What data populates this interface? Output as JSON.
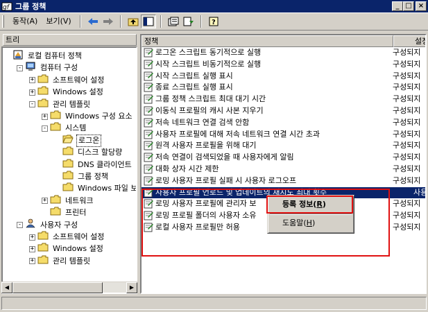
{
  "window": {
    "title": "그룹 정책",
    "minimize": "_",
    "maximize": "□",
    "close": "×"
  },
  "toolbar": {
    "menu_action_label": "동작(A)",
    "menu_view_label": "보기(V)",
    "tools": [
      "back-icon",
      "forward-icon",
      "up-folder-icon",
      "show-hide-tree-icon",
      "properties-icon",
      "export-list-icon",
      "help-icon"
    ]
  },
  "tree": {
    "header": "트리",
    "items": [
      {
        "label": "로컬 컴퓨터 정책",
        "level": 0,
        "expander": "",
        "icon": "policy-icon"
      },
      {
        "label": "컴퓨터 구성",
        "level": 1,
        "expander": "-",
        "icon": "computer-icon"
      },
      {
        "label": "소프트웨어 설정",
        "level": 2,
        "expander": "+",
        "icon": "folder-icon"
      },
      {
        "label": "Windows 설정",
        "level": 2,
        "expander": "+",
        "icon": "folder-icon"
      },
      {
        "label": "관리 템플릿",
        "level": 2,
        "expander": "-",
        "icon": "folder-icon"
      },
      {
        "label": "Windows 구성 요소",
        "level": 3,
        "expander": "+",
        "icon": "folder-icon"
      },
      {
        "label": "시스템",
        "level": 3,
        "expander": "-",
        "icon": "folder-icon"
      },
      {
        "label": "로그온",
        "level": 4,
        "expander": "",
        "icon": "folder-open-icon",
        "selected": true
      },
      {
        "label": "디스크 할당량",
        "level": 4,
        "expander": "",
        "icon": "folder-icon"
      },
      {
        "label": "DNS 클라이언트",
        "level": 4,
        "expander": "",
        "icon": "folder-icon"
      },
      {
        "label": "그룹 정책",
        "level": 4,
        "expander": "",
        "icon": "folder-icon"
      },
      {
        "label": "Windows 파일 보",
        "level": 4,
        "expander": "",
        "icon": "folder-icon"
      },
      {
        "label": "네트워크",
        "level": 3,
        "expander": "+",
        "icon": "folder-icon"
      },
      {
        "label": "프린터",
        "level": 3,
        "expander": "",
        "icon": "folder-icon"
      },
      {
        "label": "사용자 구성",
        "level": 1,
        "expander": "-",
        "icon": "user-icon"
      },
      {
        "label": "소프트웨어 설정",
        "level": 2,
        "expander": "+",
        "icon": "folder-icon"
      },
      {
        "label": "Windows 설정",
        "level": 2,
        "expander": "+",
        "icon": "folder-icon"
      },
      {
        "label": "관리 템플릿",
        "level": 2,
        "expander": "+",
        "icon": "folder-icon"
      }
    ]
  },
  "list": {
    "col_policy": "정책",
    "col_state": "설정",
    "rows": [
      {
        "name": "로그온 스크립트 동기적으로 실행",
        "state": "구성되지"
      },
      {
        "name": "시작 스크립트 비동기적으로 실행",
        "state": "구성되지"
      },
      {
        "name": "시작 스크립트 실행 표시",
        "state": "구성되지"
      },
      {
        "name": "종료 스크립트 실행 표시",
        "state": "구성되지"
      },
      {
        "name": "그룹 정책 스크립트 최대 대기 시간",
        "state": "구성되지"
      },
      {
        "name": "이동식 프로필의 캐시 사본 지우기",
        "state": "구성되지"
      },
      {
        "name": "저속 네트워크 연결 검색 안함",
        "state": "구성되지"
      },
      {
        "name": "사용자 프로필에 대해 저속 네트워크 연결 시간 초과",
        "state": "구성되지"
      },
      {
        "name": "원격 사용자 프로필을 위해 대기",
        "state": "구성되지"
      },
      {
        "name": "저속 연결이 검색되었을 때 사용자에게 알림",
        "state": "구성되지"
      },
      {
        "name": "대화 상자 시간 제한",
        "state": "구성되지"
      },
      {
        "name": "로밍 사용자 프로필 실패 시 사용자 로그오프",
        "state": "구성되지"
      },
      {
        "name": "사용자 프로필 언로드 및 업데이트의 재시도 최대 횟수",
        "state": "사용",
        "selected": true
      },
      {
        "name": "로밍 사용자 프로필에 관리자 보",
        "state": "구성되지"
      },
      {
        "name": "로밍 프로필 폴더의 사용자 소유",
        "state": "구성되지"
      },
      {
        "name": "로컬 사용자 프로필만 허용",
        "state": "구성되지"
      }
    ]
  },
  "context_menu": {
    "properties_prefix": "등록 정보(",
    "properties_key": "R",
    "properties_suffix": ")",
    "help_prefix": "도움말(",
    "help_key": "H",
    "help_suffix": ")"
  },
  "colors": {
    "titlebar": "#0a246a",
    "selection": "#0a246a",
    "highlight_box": "#e01010",
    "face": "#d4d0c8"
  }
}
